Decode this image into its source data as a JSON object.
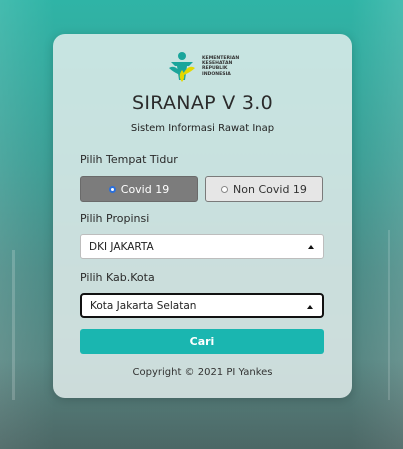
{
  "logo": {
    "lines": [
      "KEMENTERIAN",
      "KESEHATAN",
      "REPUBLIK",
      "INDONESIA"
    ],
    "colors": {
      "teal": "#1aa59b",
      "yellow": "#e4d800"
    }
  },
  "app": {
    "title": "SIRANAP V 3.0",
    "subtitle": "Sistem Informasi Rawat Inap"
  },
  "form": {
    "bed_label": "Pilih Tempat Tidur",
    "bed_options": [
      {
        "label": "Covid 19",
        "selected": true
      },
      {
        "label": "Non Covid 19",
        "selected": false
      }
    ],
    "province_label": "Pilih Propinsi",
    "province_value": "DKI JAKARTA",
    "city_label": "Pilih Kab.Kota",
    "city_value": "Kota Jakarta Selatan",
    "search_label": "Cari"
  },
  "footer": {
    "copyright": "Copyright © 2021 PI Yankes"
  },
  "colors": {
    "accent": "#1ab6b0",
    "selected_option": "#7c7c7c"
  }
}
